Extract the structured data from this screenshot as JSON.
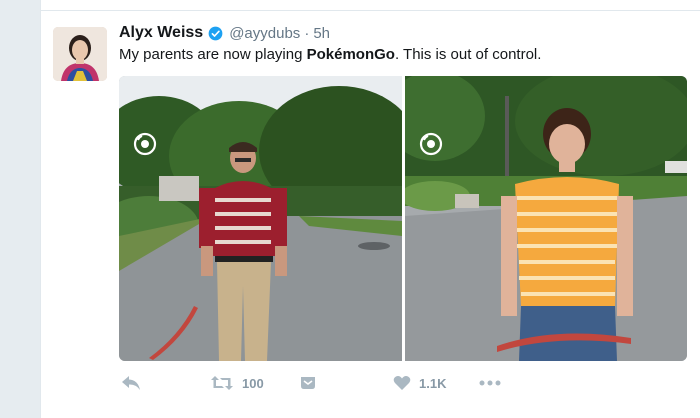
{
  "tweet": {
    "author_name": "Alyx Weiss",
    "handle": "@ayydubs",
    "separator": "·",
    "time": "5h",
    "text_before": "My parents are now playing ",
    "text_bold": "PokémonGo",
    "text_after": ". This is out of control.",
    "verified": true,
    "accent_color": "#1da1f2"
  },
  "photos": [
    {
      "subject": "man in striped polo holding red leash on road"
    },
    {
      "subject": "woman in orange striped shirt holding red leash on road"
    }
  ],
  "actions": {
    "reply_icon": "reply-icon",
    "retweet_icon": "retweet-icon",
    "retweet_count": "100",
    "dm_icon": "direct-message-icon",
    "like_icon": "heart-icon",
    "like_count": "1.1K",
    "more_icon": "more-icon"
  }
}
